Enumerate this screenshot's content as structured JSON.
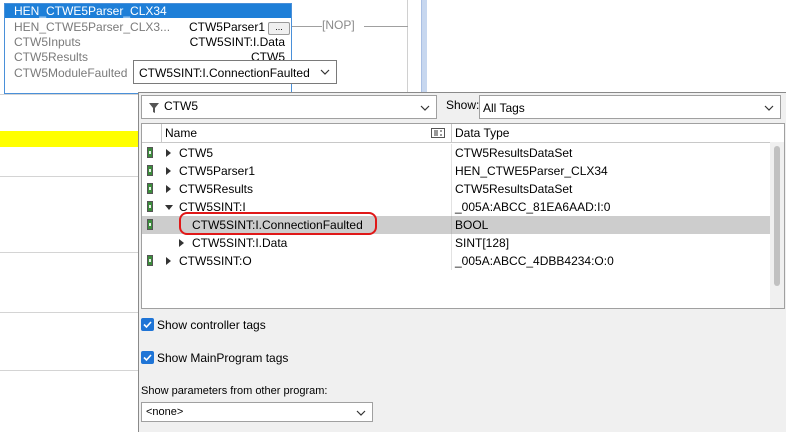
{
  "instruction": {
    "title": "HEN_CTWE5Parser_CLX34",
    "params": [
      {
        "name": "HEN_CTWE5Parser_CLX3...",
        "value": "CTW5Parser1"
      },
      {
        "name": "CTW5Inputs",
        "value": "CTW5SINT:I.Data"
      },
      {
        "name": "CTW5Results",
        "value": "CTW5"
      },
      {
        "name": "CTW5ModuleFaulted",
        "value": ""
      }
    ],
    "ellipsis_label": "...",
    "operand_value": "CTW5SINT:I.ConnectionFaulted"
  },
  "nop_label": "[NOP]",
  "browser": {
    "filter_value": "CTW5",
    "show_label": "Show:",
    "show_value": "All Tags",
    "columns": {
      "name": "Name",
      "type": "Data Type"
    },
    "rows": [
      {
        "name": "CTW5",
        "type": "CTW5ResultsDataSet"
      },
      {
        "name": "CTW5Parser1",
        "type": "HEN_CTWE5Parser_CLX34"
      },
      {
        "name": "CTW5Results",
        "type": "CTW5ResultsDataSet"
      },
      {
        "name": "CTW5SINT:I",
        "type": "_005A:ABCC_81EA6AAD:I:0"
      },
      {
        "name": "CTW5SINT:I.ConnectionFaulted",
        "type": "BOOL"
      },
      {
        "name": "CTW5SINT:I.Data",
        "type": "SINT[128]"
      },
      {
        "name": "CTW5SINT:O",
        "type": "_005A:ABCC_4DBB4234:O:0"
      }
    ],
    "show_controller_tags": "Show controller tags",
    "show_mainprogram_tags": "Show MainProgram tags",
    "params_label": "Show parameters from other program:",
    "params_value": "<none>"
  },
  "colors": {
    "accent": "#1e7fd8",
    "highlight_ring": "#e01818",
    "rung_yellow": "#ffff00"
  },
  "icons": [
    "filter-icon",
    "chevron-down-icon",
    "expand-right-icon",
    "expand-down-icon",
    "tag-marker-icon",
    "checkbox-checked-icon",
    "column-filter-icon"
  ]
}
